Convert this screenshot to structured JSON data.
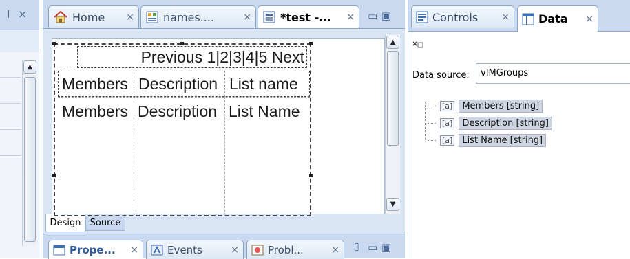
{
  "left_panel": {
    "close_glyph": "×",
    "scroll_up_glyph": "▲"
  },
  "editor": {
    "tabs": [
      {
        "label": "Home",
        "icon": "home-icon"
      },
      {
        "label": "names....",
        "icon": "names-file-icon"
      },
      {
        "label": "*test -...",
        "icon": "test-file-icon"
      }
    ],
    "close_glyph": "×",
    "minimize_glyph": "▭",
    "maximize_glyph": "▣",
    "pager_text": "Previous 1|2|3|4|5 Next",
    "header_row": [
      "Members",
      "Description",
      "List  name"
    ],
    "data_row": [
      "Members",
      "Description",
      "List Name"
    ],
    "bottom_tabs": {
      "design": "Design",
      "source": "Source"
    },
    "scroll_up_glyph": "▲",
    "scroll_down_glyph": "▼"
  },
  "bottom_panel": {
    "tabs": [
      {
        "label": "Prope...",
        "icon": "properties-icon"
      },
      {
        "label": "Events",
        "icon": "events-icon"
      },
      {
        "label": "Probl...",
        "icon": "problems-icon"
      }
    ]
  },
  "right_panel": {
    "tabs": [
      {
        "label": "Controls",
        "icon": "controls-icon"
      },
      {
        "label": "Data",
        "icon": "data-icon"
      }
    ],
    "close_glyph": "×",
    "data_source_label": "Data source:",
    "data_source_value": "vIMGroups",
    "fields": [
      {
        "label": "Members [string]"
      },
      {
        "label": "Description [string]"
      },
      {
        "label": "List Name [string]"
      }
    ],
    "field_icon_glyph": "[a]"
  },
  "colors": {
    "tab_strip": "#c9daf0",
    "panel_bg": "#d9e5f4",
    "selected_field_bg": "#cfd6e1"
  }
}
